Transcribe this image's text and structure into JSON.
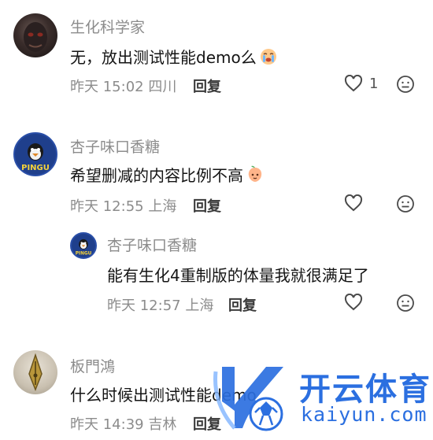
{
  "comments": [
    {
      "username": "生化科学家",
      "content": "无，放出测试性能demo么",
      "emoji": "crying-face-emoji",
      "time": "昨天 15:02",
      "location": "四川",
      "reply_label": "回复",
      "likes": "1"
    },
    {
      "username": "杏子味口香糖",
      "avatar_text": "PINGU",
      "content": "希望删减的内容比例不高",
      "emoji": "peach-face-emoji",
      "time": "昨天 12:55",
      "location": "上海",
      "reply_label": "回复"
    },
    {
      "username": "杏子味口香糖",
      "avatar_text": "PINGU",
      "content": "能有生化4重制版的体量我就很满足了",
      "time": "昨天 12:57",
      "location": "上海",
      "reply_label": "回复"
    },
    {
      "username": "板門鴻",
      "content": "什么时候出测试性能demo",
      "time": "昨天 14:39",
      "location": "吉林",
      "reply_label": "回复"
    }
  ],
  "watermark": {
    "name_cn": "开云体育",
    "name_en": "kaiyun.com",
    "brand_color": "#2b6fe0"
  },
  "colors": {
    "meta": "#8c8c8c",
    "text": "#141414"
  }
}
